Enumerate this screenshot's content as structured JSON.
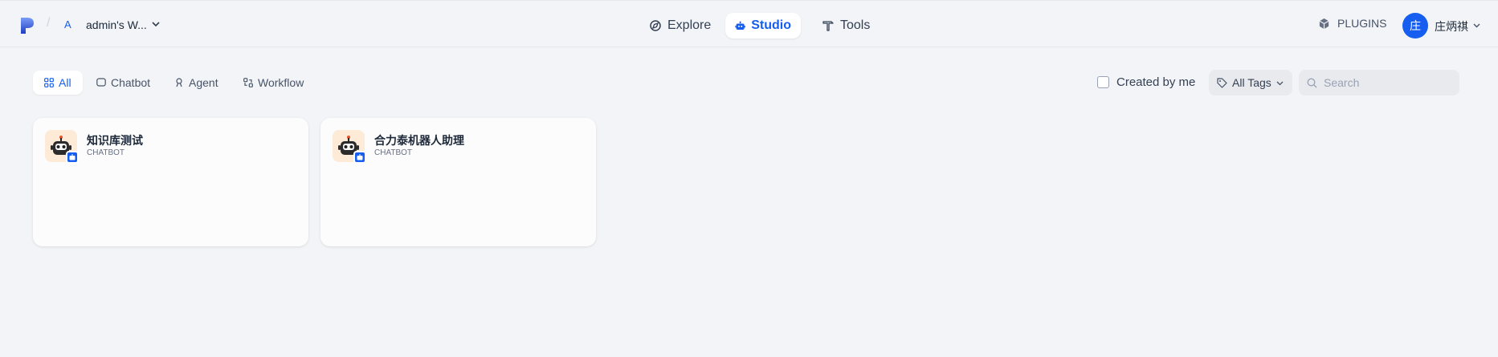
{
  "header": {
    "workspace_initial": "A",
    "workspace_name": "admin's W...",
    "nav": [
      {
        "label": "Explore",
        "icon": "compass-icon"
      },
      {
        "label": "Studio",
        "icon": "robot-icon",
        "active": true
      },
      {
        "label": "Tools",
        "icon": "hammer-icon"
      }
    ],
    "plugins_label": "PLUGINS",
    "user_initial": "庄",
    "user_name": "庄炳祺"
  },
  "filters": {
    "tabs": [
      {
        "label": "All",
        "icon": "grid-icon",
        "active": true
      },
      {
        "label": "Chatbot",
        "icon": "chat-icon"
      },
      {
        "label": "Agent",
        "icon": "agent-icon"
      },
      {
        "label": "Workflow",
        "icon": "workflow-icon"
      }
    ],
    "created_by_me_label": "Created by me",
    "created_by_me_checked": false,
    "tags_label": "All Tags",
    "search_placeholder": "Search",
    "search_value": ""
  },
  "apps": [
    {
      "name": "知识库测试",
      "type": "CHATBOT",
      "icon": "robot-avatar-icon"
    },
    {
      "name": "合力泰机器人助理",
      "type": "CHATBOT",
      "icon": "robot-avatar-icon"
    }
  ],
  "colors": {
    "accent": "#155eef",
    "background": "#f2f4f7",
    "card": "#fcfcfd",
    "icon_bg": "#fdead7"
  }
}
